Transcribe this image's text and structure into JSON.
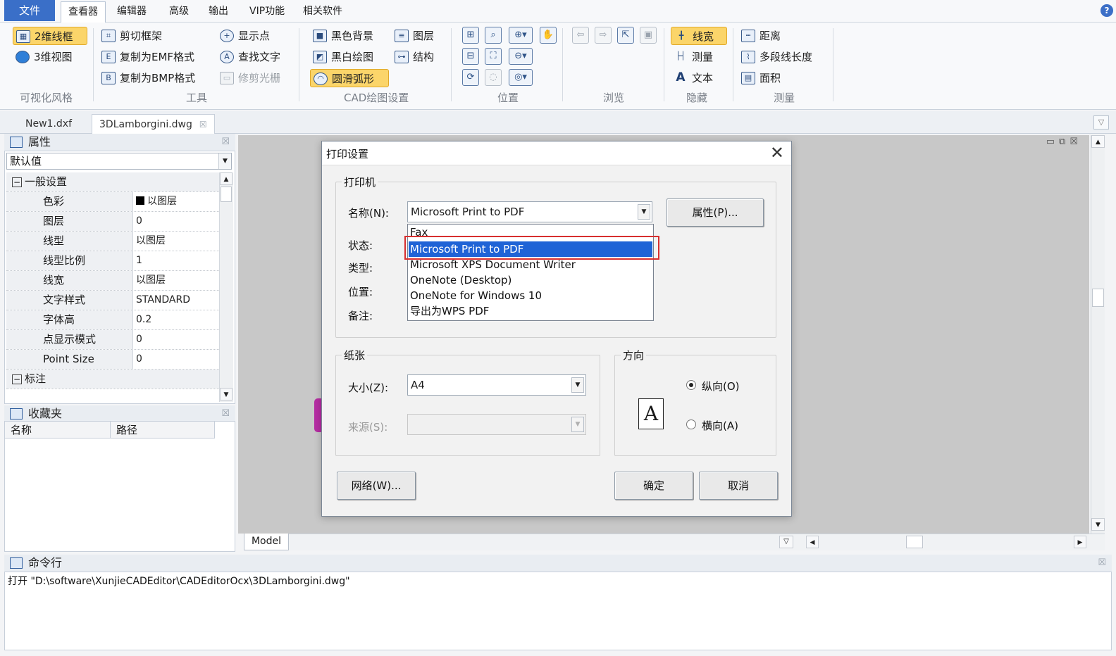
{
  "menubar": {
    "file_tab": "文件",
    "tabs": [
      "查看器",
      "编辑器",
      "高级",
      "输出",
      "VIP功能",
      "相关软件"
    ]
  },
  "ribbon": {
    "visual": {
      "btn_2d": "2维线框",
      "btn_3d": "3维视图",
      "label": "可视化风格"
    },
    "tools": {
      "clip": "剪切框架",
      "emf": "复制为EMF格式",
      "bmp": "复制为BMP格式",
      "show_points": "显示点",
      "find_text": "查找文字",
      "trim_raster": "修剪光栅",
      "label": "工具"
    },
    "cad": {
      "black_bg": "黑色背景",
      "bw_draw": "黑白绘图",
      "smooth_arc": "圆滑弧形",
      "layers": "图层",
      "structure": "结构",
      "label": "CAD绘图设置"
    },
    "position_label": "位置",
    "browse_label": "浏览",
    "hide": {
      "line_width": "线宽",
      "measure": "测量",
      "text": "文本",
      "label": "隐藏"
    },
    "measure": {
      "distance": "距离",
      "polyline_len": "多段线长度",
      "area": "面积",
      "label": "测量"
    }
  },
  "doc_tabs": [
    "New1.dxf",
    "3DLamborgini.dwg"
  ],
  "properties": {
    "title": "属性",
    "preset": "默认值",
    "rows": [
      {
        "section": true,
        "key": "一般设置"
      },
      {
        "key": "色彩",
        "value": "以图层",
        "swatch": "#000000"
      },
      {
        "key": "图层",
        "value": "0"
      },
      {
        "key": "线型",
        "value": "以图层"
      },
      {
        "key": "线型比例",
        "value": "1"
      },
      {
        "key": "线宽",
        "value": "以图层"
      },
      {
        "key": "文字样式",
        "value": "STANDARD"
      },
      {
        "key": "字体高",
        "value": "0.2"
      },
      {
        "key": "点显示模式",
        "value": "0"
      },
      {
        "key": "Point Size",
        "value": "0"
      },
      {
        "section": true,
        "key": "标注"
      }
    ]
  },
  "favorites": {
    "title": "收藏夹",
    "col_name": "名称",
    "col_path": "路径"
  },
  "model_tab": "Model",
  "command": {
    "title": "命令行",
    "line": "打开 \"D:\\software\\XunjieCADEditor\\CADEditorOcx\\3DLamborgini.dwg\""
  },
  "dialog": {
    "title": "打印设置",
    "printer_group": "打印机",
    "name_label": "名称(N):",
    "name_value": "Microsoft Print to PDF",
    "status_label": "状态:",
    "type_label": "类型:",
    "location_label": "位置:",
    "comment_label": "备注:",
    "properties_btn": "属性(P)...",
    "printer_options": [
      "Fax",
      "Microsoft Print to PDF",
      "Microsoft XPS Document Writer",
      "OneNote (Desktop)",
      "OneNote for Windows 10",
      "导出为WPS PDF"
    ],
    "paper_group": "纸张",
    "size_label": "大小(Z):",
    "size_value": "A4",
    "source_label": "来源(S):",
    "orientation_group": "方向",
    "portrait": "纵向(O)",
    "landscape": "横向(A)",
    "orientation_icon": "A",
    "network_btn": "网络(W)...",
    "ok_btn": "确定",
    "cancel_btn": "取消"
  },
  "colors": {
    "accent": "#3a6fc8",
    "highlight": "#fbd56a",
    "selection": "#1f63d6",
    "callout": "#d72f2f"
  }
}
